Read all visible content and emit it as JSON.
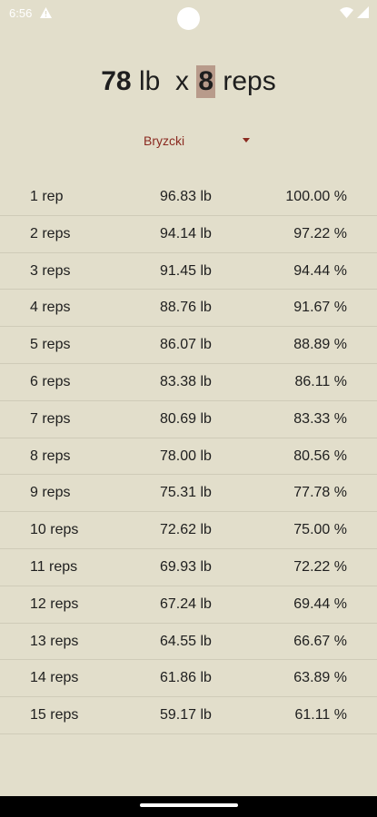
{
  "status_bar": {
    "time": "6:56"
  },
  "header": {
    "weight_value": "78",
    "weight_unit": "lb",
    "times": "x",
    "reps_value": "8",
    "reps_unit": "reps"
  },
  "formula": {
    "selected": "Bryzcki"
  },
  "table": {
    "rows": [
      {
        "reps": "1 rep",
        "weight": "96.83 lb",
        "percent": "100.00 %"
      },
      {
        "reps": "2 reps",
        "weight": "94.14 lb",
        "percent": "97.22 %"
      },
      {
        "reps": "3 reps",
        "weight": "91.45 lb",
        "percent": "94.44 %"
      },
      {
        "reps": "4 reps",
        "weight": "88.76 lb",
        "percent": "91.67 %"
      },
      {
        "reps": "5 reps",
        "weight": "86.07 lb",
        "percent": "88.89 %"
      },
      {
        "reps": "6 reps",
        "weight": "83.38 lb",
        "percent": "86.11 %"
      },
      {
        "reps": "7 reps",
        "weight": "80.69 lb",
        "percent": "83.33 %"
      },
      {
        "reps": "8 reps",
        "weight": "78.00 lb",
        "percent": "80.56 %"
      },
      {
        "reps": "9 reps",
        "weight": "75.31 lb",
        "percent": "77.78 %"
      },
      {
        "reps": "10 reps",
        "weight": "72.62 lb",
        "percent": "75.00 %"
      },
      {
        "reps": "11 reps",
        "weight": "69.93 lb",
        "percent": "72.22 %"
      },
      {
        "reps": "12 reps",
        "weight": "67.24 lb",
        "percent": "69.44 %"
      },
      {
        "reps": "13 reps",
        "weight": "64.55 lb",
        "percent": "66.67 %"
      },
      {
        "reps": "14 reps",
        "weight": "61.86 lb",
        "percent": "63.89 %"
      },
      {
        "reps": "15 reps",
        "weight": "59.17 lb",
        "percent": "61.11 %"
      }
    ]
  },
  "colors": {
    "background": "#e2decb",
    "accent": "#8a2a20",
    "reps_highlight": "#b89b8b"
  },
  "icons": [
    "warning-icon",
    "wifi-icon",
    "signal-icon",
    "chevron-down-icon"
  ]
}
